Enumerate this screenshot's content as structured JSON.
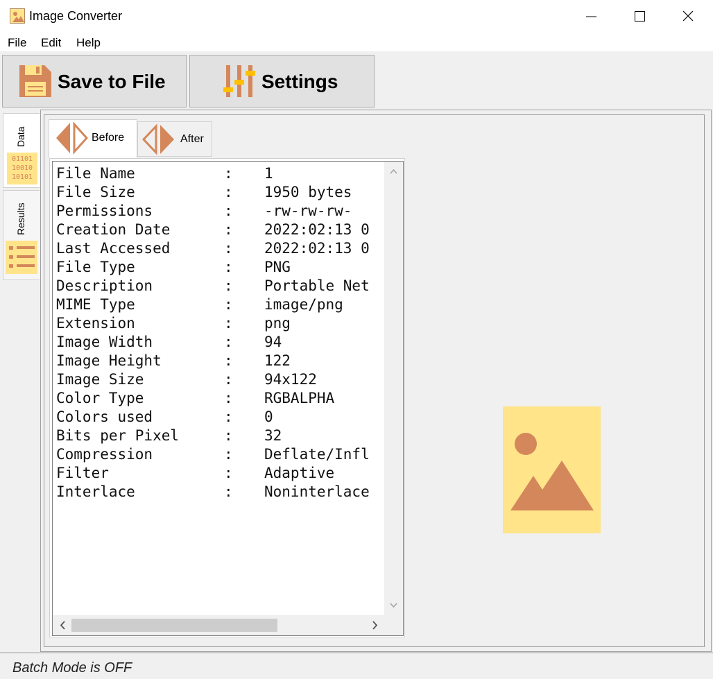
{
  "window": {
    "title": "Image Converter",
    "icon": "image-icon",
    "controls": {
      "minimize": "minimize-icon",
      "maximize": "maximize-icon",
      "close": "close-icon"
    }
  },
  "menu": [
    "File",
    "Edit",
    "Help"
  ],
  "toolbar": {
    "save_label": "Save to File",
    "save_icon": "floppy-disk-icon",
    "settings_label": "Settings",
    "settings_icon": "sliders-icon"
  },
  "sidebar": {
    "tabs": [
      {
        "label": "Data",
        "icon": "binary-icon",
        "icon_text": [
          "01101",
          "10010",
          "10101"
        ]
      },
      {
        "label": "Results",
        "icon": "list-icon"
      }
    ]
  },
  "tabs": [
    {
      "label": "Before",
      "icon": "arrows-icon",
      "active": true
    },
    {
      "label": "After",
      "icon": "arrows-icon",
      "active": false
    }
  ],
  "file_info": [
    {
      "key": "File Name",
      "sep": ":",
      "value": "1"
    },
    {
      "key": "File Size",
      "sep": ":",
      "value": "1950 bytes"
    },
    {
      "key": "Permissions",
      "sep": ":",
      "value": "-rw-rw-rw-"
    },
    {
      "key": "Creation Date",
      "sep": ":",
      "value": "2022:02:13 0"
    },
    {
      "key": "Last Accessed",
      "sep": ":",
      "value": "2022:02:13 0"
    },
    {
      "key": "File Type",
      "sep": ":",
      "value": "PNG"
    },
    {
      "key": "Description",
      "sep": ":",
      "value": "Portable Net"
    },
    {
      "key": "MIME Type",
      "sep": ":",
      "value": "image/png"
    },
    {
      "key": "Extension",
      "sep": ":",
      "value": "png"
    },
    {
      "key": "Image Width",
      "sep": ":",
      "value": "94"
    },
    {
      "key": "Image Height",
      "sep": ":",
      "value": "122"
    },
    {
      "key": "Image Size",
      "sep": ":",
      "value": "94x122"
    },
    {
      "key": "Color Type",
      "sep": ":",
      "value": "RGBALPHA"
    },
    {
      "key": "Colors used",
      "sep": ":",
      "value": "0"
    },
    {
      "key": "Bits per Pixel",
      "sep": ":",
      "value": "32"
    },
    {
      "key": "Compression",
      "sep": ":",
      "value": "Deflate/Infl"
    },
    {
      "key": "Filter",
      "sep": ":",
      "value": "Adaptive"
    },
    {
      "key": "Interlace",
      "sep": ":",
      "value": "Noninterlace"
    }
  ],
  "preview": {
    "icon": "image-placeholder-icon"
  },
  "status": {
    "text": "Batch Mode is OFF"
  },
  "colors": {
    "accent": "#d4875a",
    "highlight": "#ffe48a",
    "background": "#f0f0f0"
  }
}
